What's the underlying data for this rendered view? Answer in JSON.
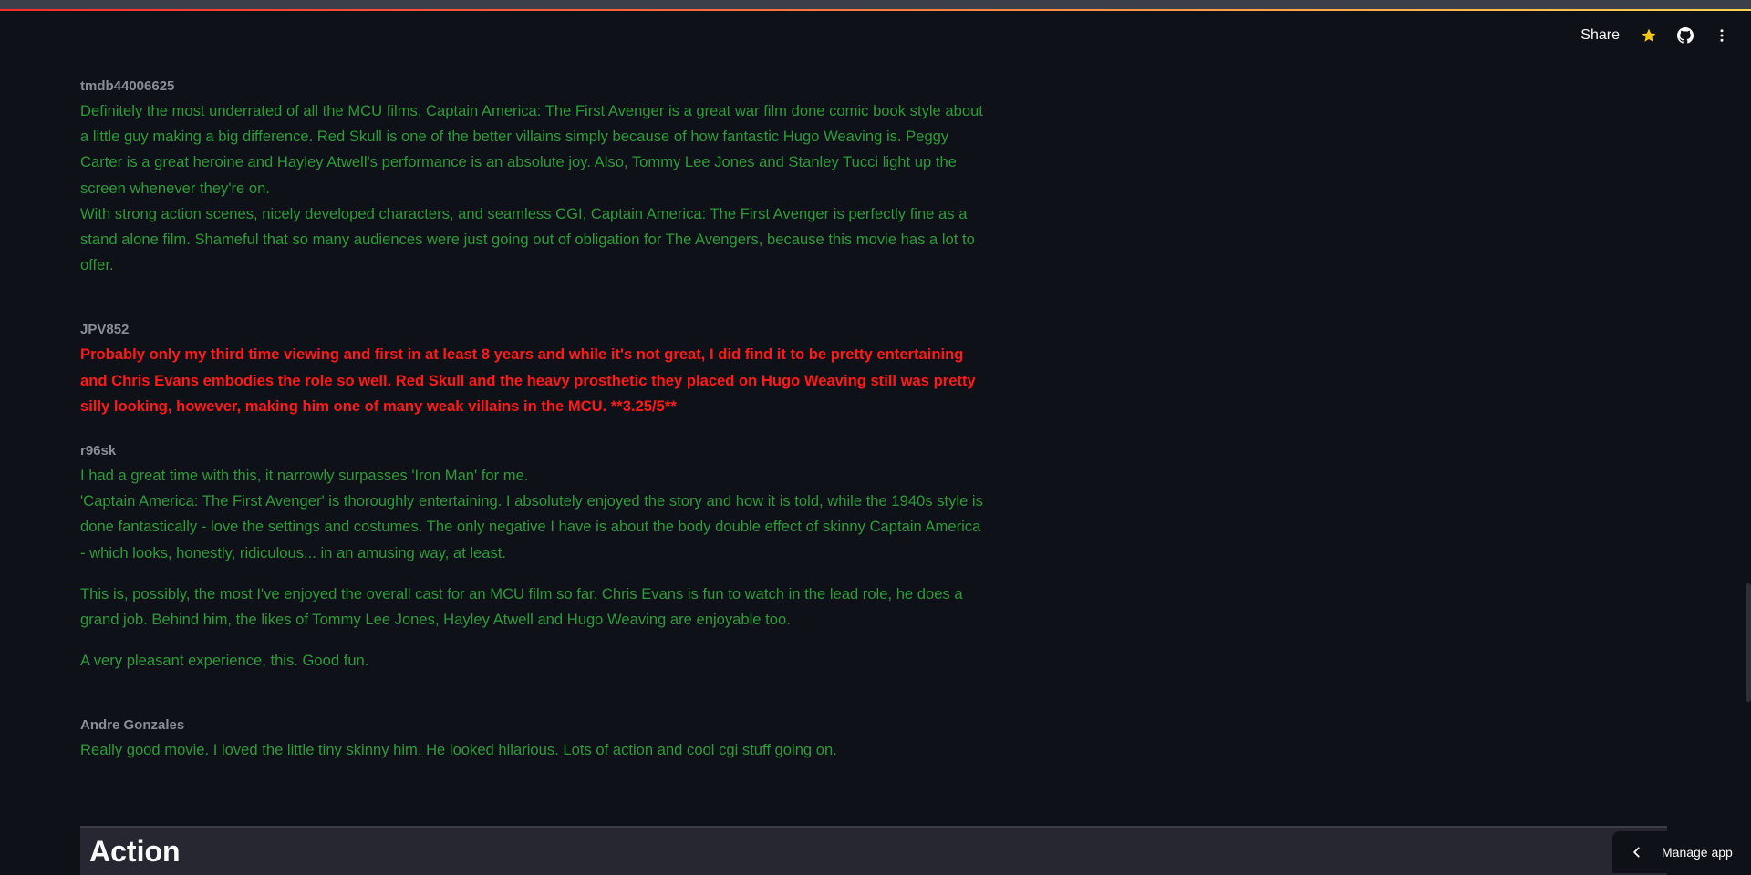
{
  "toolbar": {
    "share_label": "Share",
    "icons": [
      "star-icon",
      "github-icon",
      "more-vertical-icon"
    ]
  },
  "reviews": [
    {
      "author": "tmdb44006625",
      "sentiment": "positive",
      "paragraphs": [
        "Definitely the most underrated of all the MCU films, Captain America: The First Avenger is a great war film done comic book style about a little guy making a big difference. Red Skull is one of the better villains simply because of how fantastic Hugo Weaving is. Peggy Carter is a great heroine and Hayley Atwell's performance is an absolute joy. Also, Tommy Lee Jones and Stanley Tucci light up the screen whenever they're on.",
        "With strong action scenes, nicely developed characters, and seamless CGI, Captain America: The First Avenger is perfectly fine as a stand alone film. Shameful that so many audiences were just going out of obligation for The Avengers, because this movie has a lot to offer."
      ]
    },
    {
      "author": "JPV852",
      "sentiment": "negative",
      "paragraphs": [
        "Probably only my third time viewing and first in at least 8 years and while it's not great, I did find it to be pretty entertaining and Chris Evans embodies the role so well. Red Skull and the heavy prosthetic they placed on Hugo Weaving still was pretty silly looking, however, making him one of many weak villains in the MCU. **3.25/5**"
      ]
    },
    {
      "author": "r96sk",
      "sentiment": "positive",
      "paragraphs": [
        "I had a great time with this, it narrowly surpasses 'Iron Man' for me.",
        "'Captain America: The First Avenger' is thoroughly entertaining. I absolutely enjoyed the story and how it is told, while the 1940s style is done fantastically - love the settings and costumes. The only negative I have is about the body double effect of skinny Captain America - which looks, honestly, ridiculous... in an amusing way, at least.",
        "This is, possibly, the most I've enjoyed the overall cast for an MCU film so far. Chris Evans is fun to watch in the lead role, he does a grand job. Behind him, the likes of Tommy Lee Jones, Hayley Atwell and Hugo Weaving are enjoyable too.",
        "A very pleasant experience, this. Good fun."
      ]
    },
    {
      "author": "Andre Gonzales",
      "sentiment": "positive",
      "paragraphs": [
        "Really good movie. I loved the little tiny skinny him. He looked hilarious. Lots of action and cool cgi stuff going on."
      ]
    }
  ],
  "section_header": "Action",
  "manage_app_label": "Manage app",
  "colors": {
    "background": "#0e1117",
    "positive_text": "#2e9a3a",
    "negative_text": "#ff1a1a",
    "author_text": "#8a8d93",
    "star": "#f5c518"
  }
}
